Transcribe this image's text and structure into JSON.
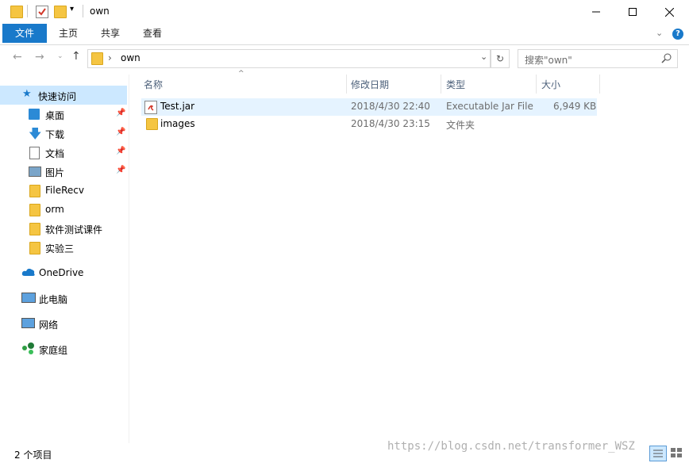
{
  "window": {
    "title": "own"
  },
  "ribbon": {
    "tabs": [
      "文件",
      "主页",
      "共享",
      "查看"
    ]
  },
  "address": {
    "path_segment": "own",
    "separator": "›"
  },
  "search": {
    "placeholder": "搜索\"own\""
  },
  "nav": {
    "quick_access": "快速访问",
    "pinned": [
      {
        "label": "桌面",
        "icon": "desktop-icon"
      },
      {
        "label": "下载",
        "icon": "download-icon"
      },
      {
        "label": "文档",
        "icon": "document-icon"
      },
      {
        "label": "图片",
        "icon": "pictures-icon"
      }
    ],
    "folders": [
      "FileRecv",
      "orm",
      "软件测试课件",
      "实验三"
    ],
    "onedrive": "OneDrive",
    "this_pc": "此电脑",
    "network": "网络",
    "homegroup": "家庭组"
  },
  "columns": {
    "name": "名称",
    "date": "修改日期",
    "type": "类型",
    "size": "大小"
  },
  "files": [
    {
      "name": "Test.jar",
      "date": "2018/4/30 22:40",
      "type": "Executable Jar File",
      "size": "6,949 KB",
      "icon": "jar-file-icon",
      "selected": true
    },
    {
      "name": "images",
      "date": "2018/4/30 23:15",
      "type": "文件夹",
      "size": "",
      "icon": "folder-icon",
      "selected": false
    }
  ],
  "status": {
    "item_count": "2 个项目"
  },
  "watermark": "https://blog.csdn.net/transformer_WSZ",
  "colors": {
    "accent": "#1979ca",
    "selected_row": "#e5f3ff",
    "header_text": "#4c607a"
  }
}
